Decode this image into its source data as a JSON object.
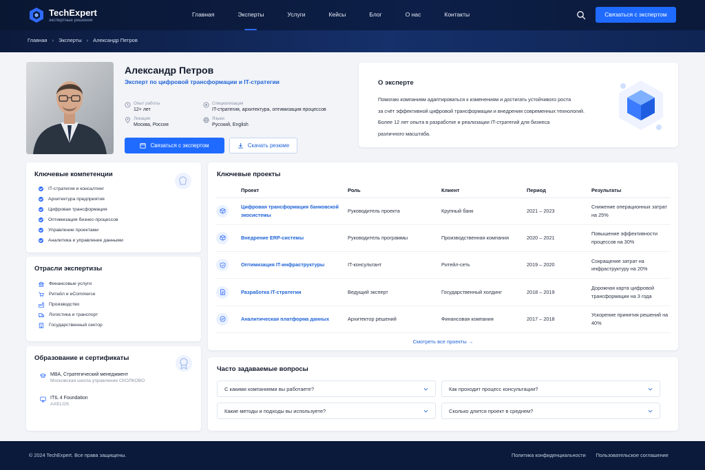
{
  "brand": {
    "name": "TechExpert",
    "tagline": "экспертные решения",
    "accent": "#1f6bff",
    "dark": "#0b1a3a"
  },
  "nav": {
    "items": [
      "Главная",
      "Эксперты",
      "Услуги",
      "Кейсы",
      "Блог",
      "О нас",
      "Контакты"
    ],
    "active": "Эксперты",
    "cta": "Связаться с экспертом"
  },
  "breadcrumb": [
    "Главная",
    "Эксперты",
    "Александр Петров"
  ],
  "expert": {
    "name": "Александр Петров",
    "role": "Эксперт по цифровой трансформации и IT-стратегии",
    "meta": [
      {
        "label": "Опыт работы",
        "value": "12+ лет",
        "icon": "clock-icon"
      },
      {
        "label": "Специализация",
        "value": "IT-стратегия, архитектура, оптимизация процессов",
        "icon": "target-icon"
      },
      {
        "label": "Локация",
        "value": "Москва, Россия",
        "icon": "location-icon"
      },
      {
        "label": "Языки",
        "value": "Русский, English",
        "icon": "globe-icon"
      }
    ],
    "contact_button": "Связаться с экспертом",
    "resume_button": "Скачать резюме"
  },
  "about": {
    "title": "О эксперте",
    "lines": [
      "Помогаю компаниям адаптироваться к изменениям и достигать устойчивого роста",
      "за счёт эффективной цифровой трансформации и внедрения современных технологий.",
      "Более 12 лет опыта в разработке и реализации IT-стратегий для бизнеса",
      "различного масштаба."
    ]
  },
  "competencies": {
    "title": "Ключевые компетенции",
    "items": [
      "IT-стратегия и консалтинг",
      "Архитектура предприятия",
      "Цифровая трансформация",
      "Оптимизация бизнес-процессов",
      "Управление проектами",
      "Аналитика и управление данными"
    ]
  },
  "industries": {
    "title": "Отрасли экспертизы",
    "items": [
      {
        "label": "Финансовые услуги",
        "icon": "bank-icon"
      },
      {
        "label": "Ритейл и eCommerce",
        "icon": "cart-icon"
      },
      {
        "label": "Производство",
        "icon": "factory-icon"
      },
      {
        "label": "Логистика и транспорт",
        "icon": "truck-icon"
      },
      {
        "label": "Государственный сектор",
        "icon": "building-icon"
      }
    ]
  },
  "education": {
    "title": "Образование и сертификаты",
    "items": [
      {
        "title": "MBA, Стратегический менеджмент",
        "sub": "Московская школа управления СКОЛКОВО"
      },
      {
        "title": "ITIL 4 Foundation",
        "sub": "AXELOS"
      }
    ]
  },
  "projects": {
    "title": "Ключевые проекты",
    "columns": [
      "Проект",
      "Роль",
      "Клиент",
      "Период",
      "Результаты"
    ],
    "rows": [
      {
        "project": "Цифровая трансформация банковской экосистемы",
        "role": "Руководитель проекта",
        "client": "Крупный банк",
        "period": "2021 – 2023",
        "result": "Снижение операционных затрат на 25%"
      },
      {
        "project": "Внедрение ERP-системы",
        "role": "Руководитель программы",
        "client": "Производственная компания",
        "period": "2020 – 2021",
        "result": "Повышение эффективности процессов на 30%"
      },
      {
        "project": "Оптимизация IT-инфраструктуры",
        "role": "IT-консультант",
        "client": "Ритейл-сеть",
        "period": "2019 – 2020",
        "result": "Сокращение затрат на инфраструктуру на 20%"
      },
      {
        "project": "Разработка IT-стратегии",
        "role": "Ведущий эксперт",
        "client": "Государственный холдинг",
        "period": "2018 – 2019",
        "result": "Дорожная карта цифровой трансформации на 3 года"
      },
      {
        "project": "Аналитическая платформа данных",
        "role": "Архитектор решений",
        "client": "Финансовая компания",
        "period": "2017 – 2018",
        "result": "Ускорение принятия решений на 40%"
      }
    ],
    "see_all": "Смотреть все проекты →"
  },
  "faq": {
    "title": "Часто задаваемые вопросы",
    "items": [
      "С какими компаниями вы работаете?",
      "Как проходит процесс консультации?",
      "Какие методы и подходы вы используете?",
      "Сколько длится проект в среднем?"
    ]
  },
  "footer": {
    "copyright": "© 2024 TechExpert. Все права защищены.",
    "links": [
      "Политика конфиденциальности",
      "Пользовательское соглашение"
    ]
  }
}
